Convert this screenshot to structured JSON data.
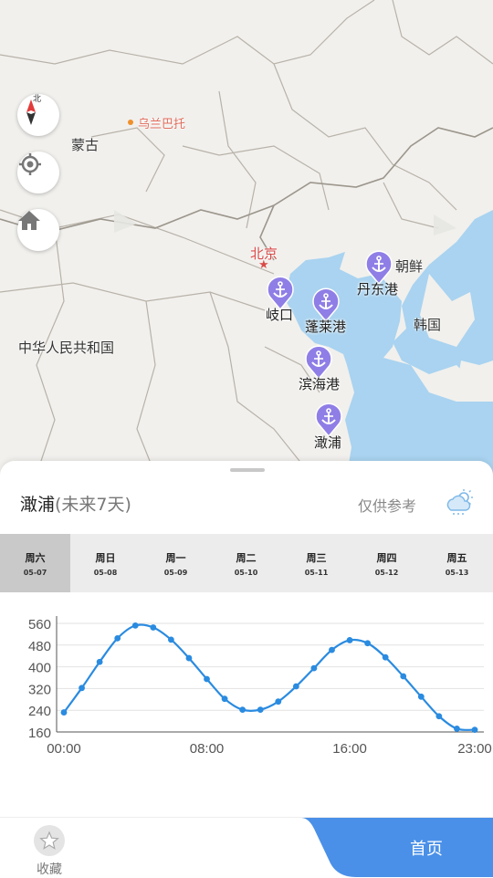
{
  "map": {
    "compass_label": "北",
    "labels": {
      "mongolia": "蒙古",
      "ulaanbaatar": "乌兰巴托",
      "china": "中华人民共和国",
      "beijing": "北京",
      "north_korea": "朝鲜",
      "south_korea": "韩国"
    },
    "ports": [
      {
        "name": "岐口"
      },
      {
        "name": "蓬莱港"
      },
      {
        "name": "丹东港"
      },
      {
        "name": "滨海港"
      },
      {
        "name": "澉浦"
      }
    ],
    "colors": {
      "sea": "#a9d3f0",
      "land": "#f1f0ed",
      "border": "#b0aaa0",
      "port": "#8f7ee6",
      "capital": "#d94a48"
    }
  },
  "panel": {
    "port_name": "澉浦",
    "subtitle": "(未来7天)",
    "reference": "仅供参考"
  },
  "days": [
    {
      "weekday": "周六",
      "date": "05-07",
      "selected": true
    },
    {
      "weekday": "周日",
      "date": "05-08",
      "selected": false
    },
    {
      "weekday": "周一",
      "date": "05-09",
      "selected": false
    },
    {
      "weekday": "周二",
      "date": "05-10",
      "selected": false
    },
    {
      "weekday": "周三",
      "date": "05-11",
      "selected": false
    },
    {
      "weekday": "周四",
      "date": "05-12",
      "selected": false
    },
    {
      "weekday": "周五",
      "date": "05-13",
      "selected": false
    }
  ],
  "chart_data": {
    "type": "line",
    "x": [
      "00:00",
      "01:00",
      "02:00",
      "03:00",
      "04:00",
      "05:00",
      "06:00",
      "07:00",
      "08:00",
      "09:00",
      "10:00",
      "11:00",
      "12:00",
      "13:00",
      "14:00",
      "15:00",
      "16:00",
      "17:00",
      "18:00",
      "19:00",
      "20:00",
      "21:00",
      "22:00",
      "23:00"
    ],
    "values": [
      232,
      322,
      418,
      505,
      552,
      545,
      500,
      432,
      355,
      282,
      242,
      242,
      272,
      328,
      395,
      462,
      498,
      487,
      435,
      365,
      290,
      218,
      172,
      168
    ],
    "x_ticks": [
      "00:00",
      "08:00",
      "16:00",
      "23:00"
    ],
    "y_ticks": [
      160,
      240,
      320,
      400,
      480,
      560
    ],
    "ylim": [
      160,
      560
    ],
    "grid": true,
    "color": "#2a8be0"
  },
  "bottom_bar": {
    "favorites_label": "收藏",
    "home_label": "首页",
    "accent": "#4a90e8"
  }
}
